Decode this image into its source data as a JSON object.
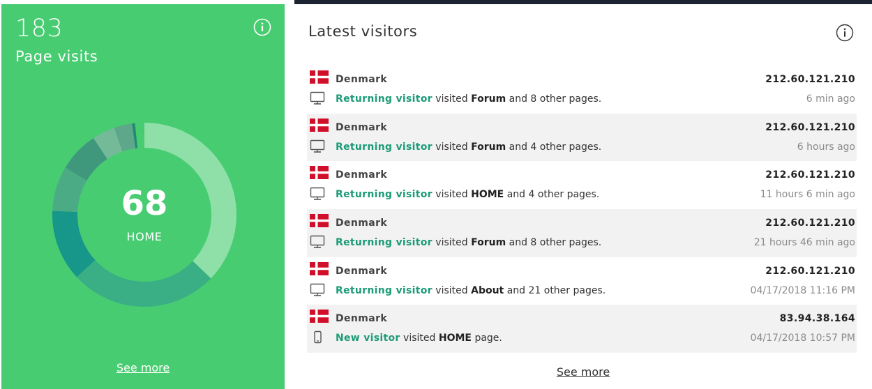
{
  "page_visits_card": {
    "count": "183",
    "subtitle": "Page visits",
    "info_icon": "info-icon",
    "donut": {
      "center_value": "68",
      "center_label": "HOME",
      "segments": [
        {
          "fraction": 0.3716,
          "color": "#8ee0a8"
        },
        {
          "fraction": 0.26,
          "color": "#3aaf85"
        },
        {
          "fraction": 0.125,
          "color": "#17968a"
        },
        {
          "fraction": 0.079,
          "color": "#4aab85"
        },
        {
          "fraction": 0.071,
          "color": "#3f987c"
        },
        {
          "fraction": 0.04,
          "color": "#74ba98"
        },
        {
          "fraction": 0.032,
          "color": "#5ea78b"
        },
        {
          "fraction": 0.005,
          "color": "#1f8b74"
        }
      ]
    },
    "see_more": "See more"
  },
  "latest_visitors_card": {
    "title": "Latest visitors",
    "info_icon": "info-icon",
    "link_color": "#1d9b78",
    "visitors": [
      {
        "country": "Denmark",
        "flag": "denmark-flag",
        "ip": "212.60.121.210",
        "device": "desktop-icon",
        "type": "Returning visitor",
        "w1": "visited",
        "page": "Forum",
        "w2": "and 8 other pages.",
        "time": "6 min ago"
      },
      {
        "country": "Denmark",
        "flag": "denmark-flag",
        "ip": "212.60.121.210",
        "device": "desktop-icon",
        "type": "Returning visitor",
        "w1": "visited",
        "page": "Forum",
        "w2": "and 4 other pages.",
        "time": "6 hours ago"
      },
      {
        "country": "Denmark",
        "flag": "denmark-flag",
        "ip": "212.60.121.210",
        "device": "desktop-icon",
        "type": "Returning visitor",
        "w1": "visited",
        "page": "HOME",
        "w2": "and 4 other pages.",
        "time": "11 hours 6 min ago"
      },
      {
        "country": "Denmark",
        "flag": "denmark-flag",
        "ip": "212.60.121.210",
        "device": "desktop-icon",
        "type": "Returning visitor",
        "w1": "visited",
        "page": "Forum",
        "w2": "and 8 other pages.",
        "time": "21 hours 46 min ago"
      },
      {
        "country": "Denmark",
        "flag": "denmark-flag",
        "ip": "212.60.121.210",
        "device": "desktop-icon",
        "type": "Returning visitor",
        "w1": "visited",
        "page": "About",
        "w2": "and 21 other pages.",
        "time": "04/17/2018 11:16 PM"
      },
      {
        "country": "Denmark",
        "flag": "denmark-flag",
        "ip": "83.94.38.164",
        "device": "mobile-icon",
        "type": "New visitor",
        "w1": "visited",
        "page": "HOME",
        "w2": "page.",
        "time": "04/17/2018 10:57 PM"
      }
    ],
    "see_more": "See more"
  }
}
